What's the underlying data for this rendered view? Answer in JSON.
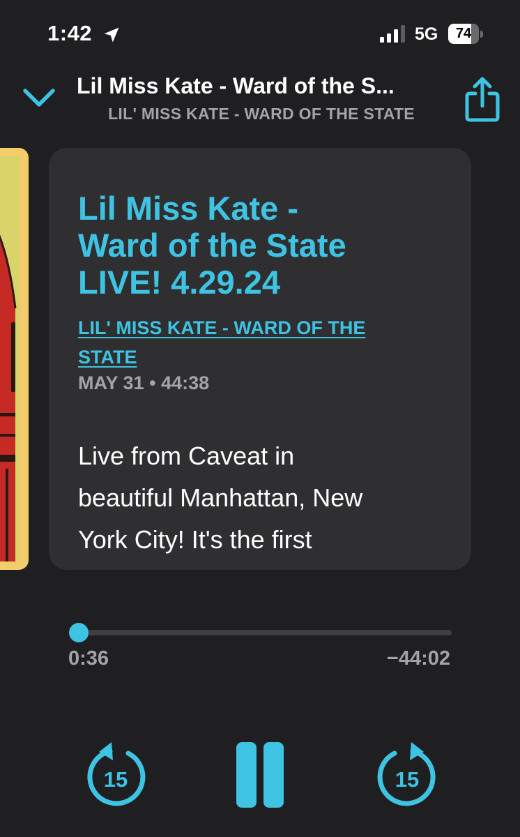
{
  "status_bar": {
    "time": "1:42",
    "network": "5G",
    "battery_percent": "74",
    "battery_level": 0.74,
    "location_icon": "location-arrow-icon",
    "signal_icon": "signal-bars-icon"
  },
  "header": {
    "title": "Lil Miss Kate - Ward of the S...",
    "subtitle": "LIL' MISS KATE - WARD OF THE STATE",
    "collapse_icon": "chevron-down-icon",
    "share_icon": "share-icon"
  },
  "episode": {
    "title_lines": [
      "Lil Miss Kate -",
      "Ward of the State",
      "LIVE! 4.29.24"
    ],
    "podcast_lines": [
      "LIL' MISS KATE - WARD OF THE",
      "STATE"
    ],
    "date": "MAY 31",
    "separator": "•",
    "duration": "44:38",
    "description_lines": [
      "Live from Caveat in",
      "beautiful Manhattan, New",
      "York City! It's the first"
    ]
  },
  "player": {
    "elapsed": "0:36",
    "remaining": "−44:02",
    "progress": 0.0134,
    "skip_back_seconds": "15",
    "skip_forward_seconds": "15",
    "skip_back_icon": "skip-back-15-icon",
    "skip_forward_icon": "skip-forward-15-icon",
    "pause_icon": "pause-icon"
  },
  "colors": {
    "accent": "#3ec3e2",
    "background": "#1f1f21",
    "card": "#2f2f31",
    "secondary_text": "#a4a4a8",
    "artwork_frame": "#f3cd6b",
    "artwork_red": "#c52a24"
  }
}
